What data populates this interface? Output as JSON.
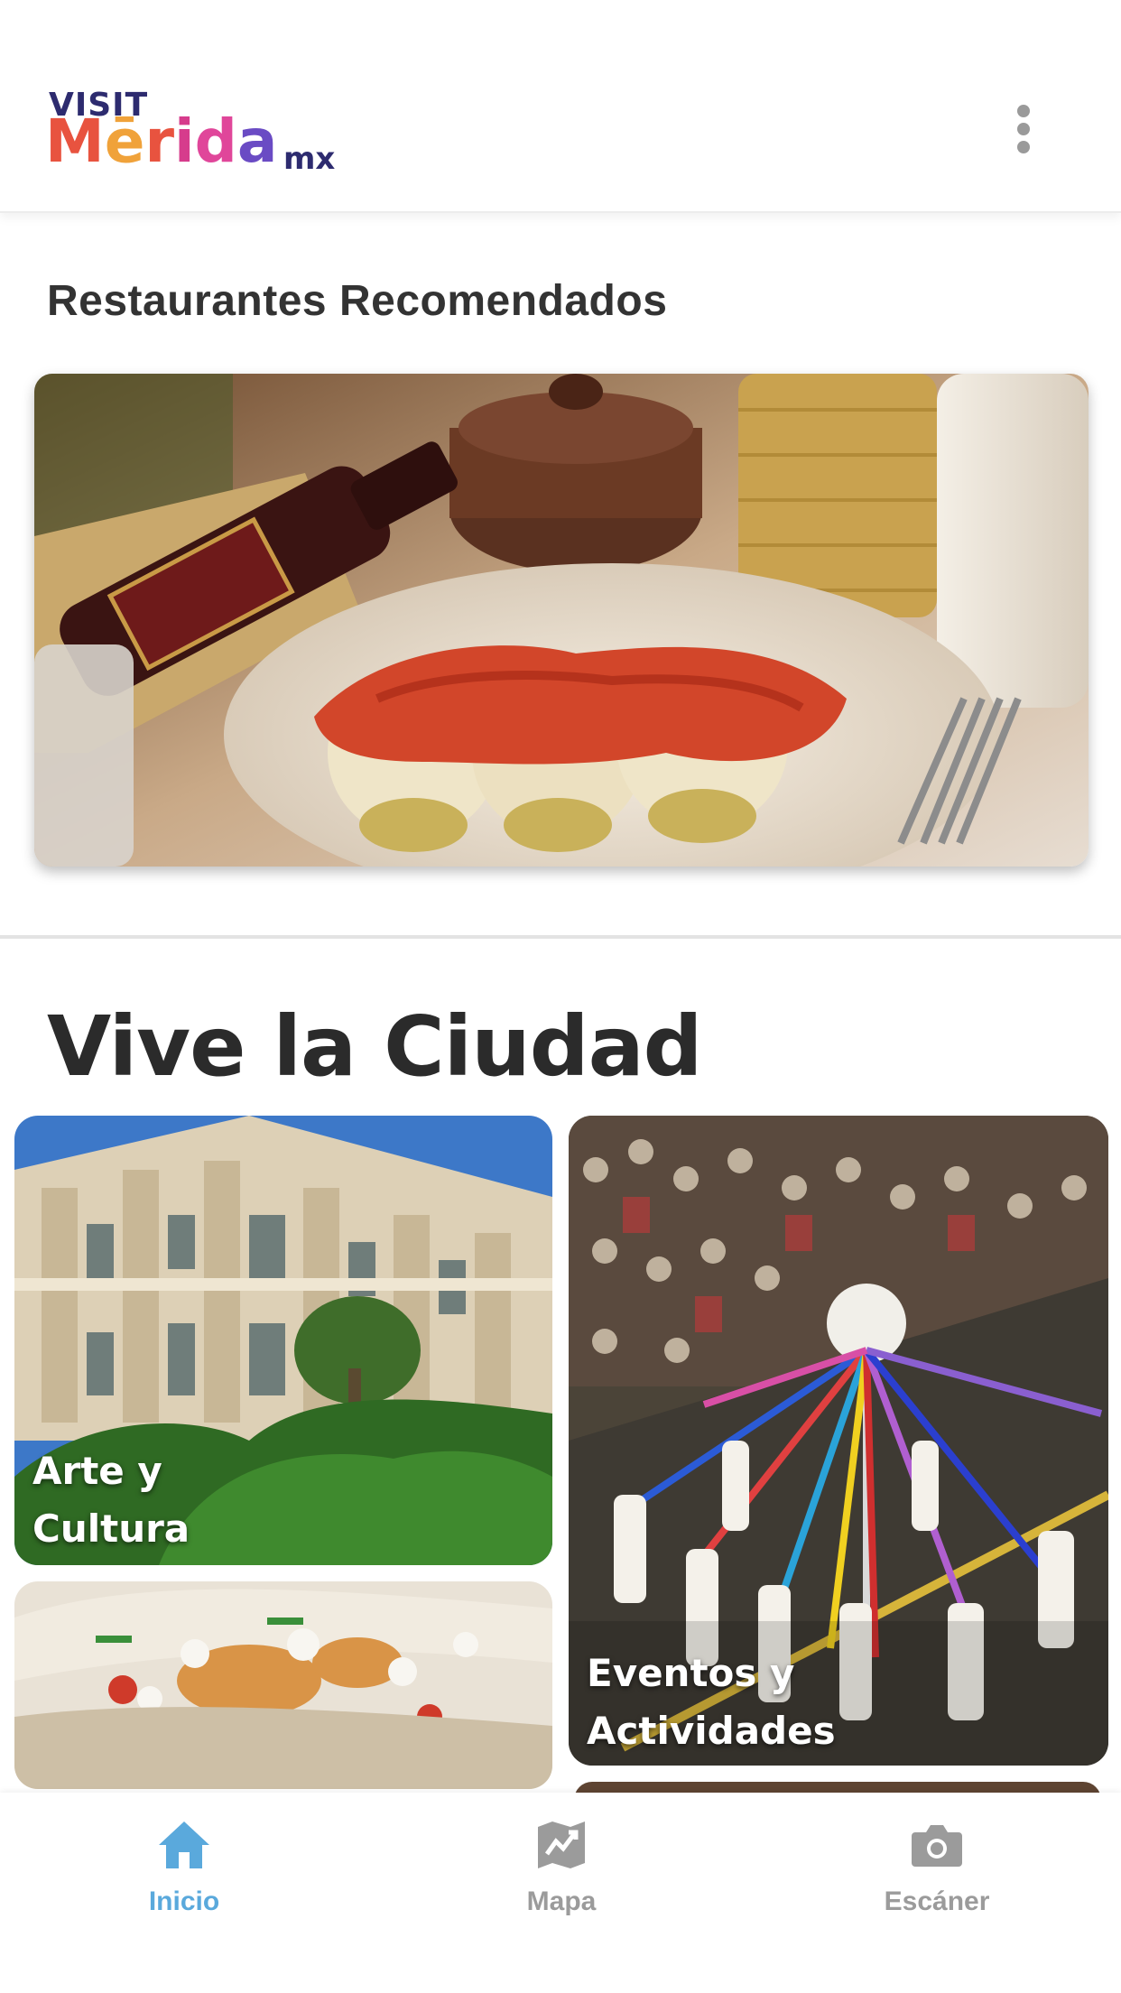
{
  "header": {
    "logo": {
      "visit": "VISIT",
      "merida": "Mērida",
      "suffix": "mx"
    },
    "menu_icon": "more-vertical-icon"
  },
  "restaurants": {
    "title": "Restaurantes Recomendados"
  },
  "city": {
    "title": "Vive la Ciudad",
    "tiles": [
      {
        "label": "Arte y\nCultura"
      },
      {
        "label": "Eventos y\nActividades"
      }
    ]
  },
  "bottom_nav": {
    "items": [
      {
        "label": "Inicio",
        "icon": "home-icon",
        "active": true
      },
      {
        "label": "Mapa",
        "icon": "map-icon",
        "active": false
      },
      {
        "label": "Escáner",
        "icon": "camera-icon",
        "active": false
      }
    ]
  },
  "colors": {
    "accent": "#5aa9dc",
    "inactive": "#9b9b9b",
    "logo_navy": "#2d2b6f"
  }
}
